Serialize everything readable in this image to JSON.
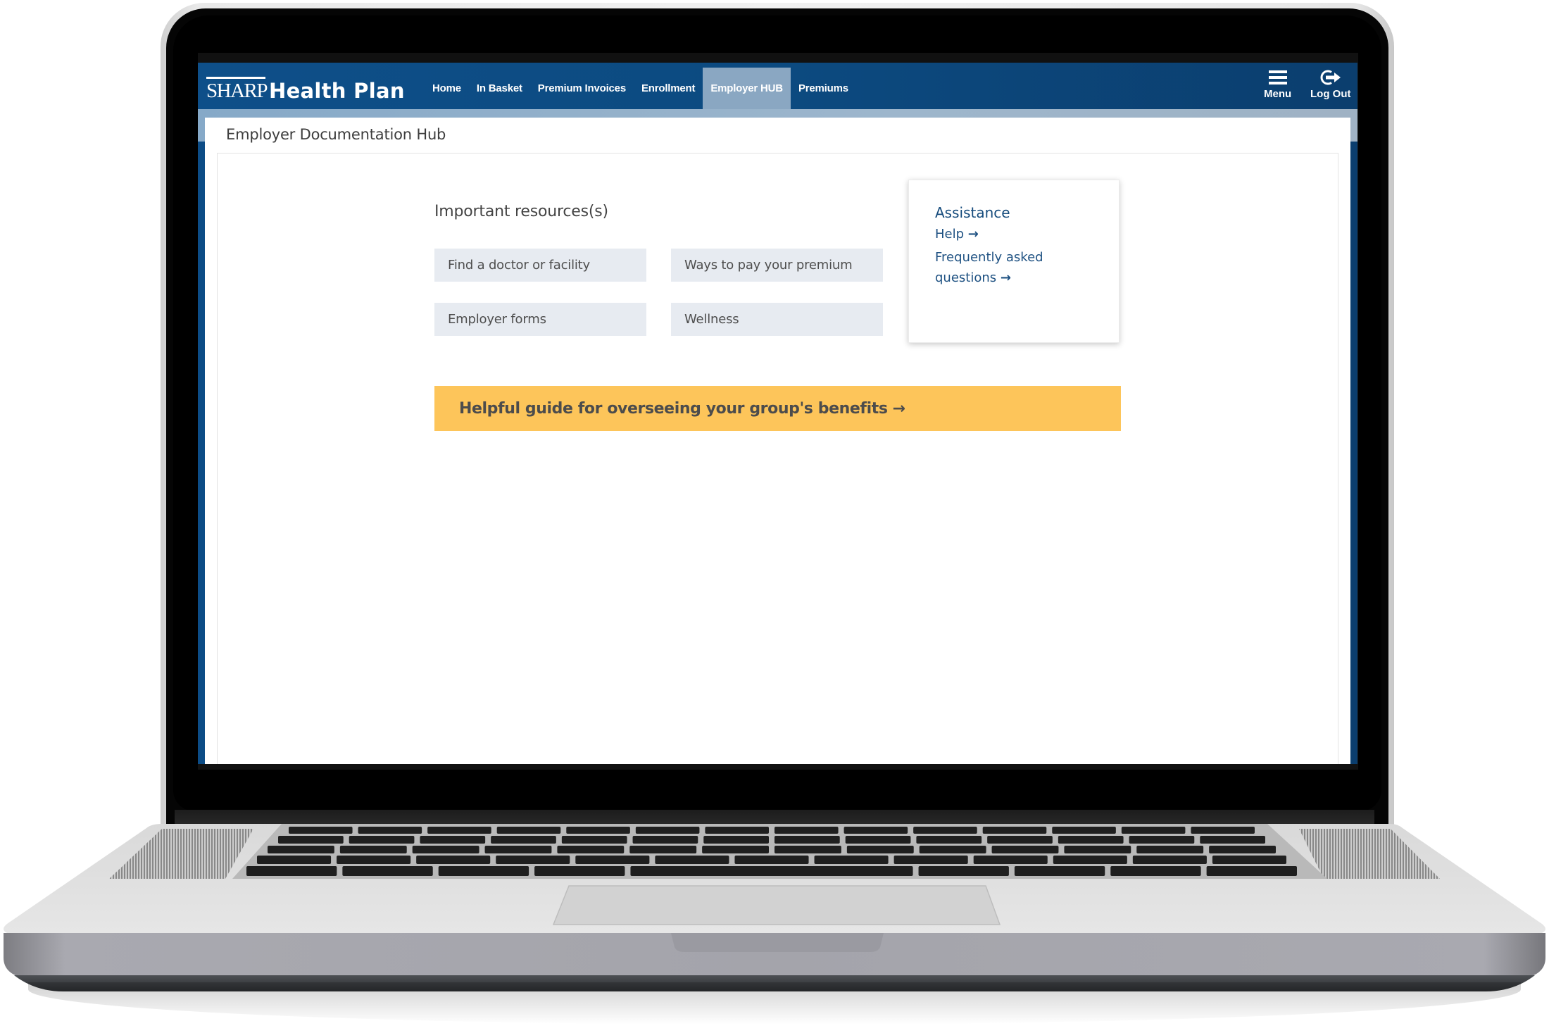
{
  "app": {
    "brand_sharp": "SHARP",
    "brand_rest": "Health Plan"
  },
  "nav": {
    "items": [
      {
        "label": "Home",
        "active": false
      },
      {
        "label": "In Basket",
        "active": false
      },
      {
        "label": "Premium Invoices",
        "active": false
      },
      {
        "label": "Enrollment",
        "active": false
      },
      {
        "label": "Employer HUB",
        "active": true
      },
      {
        "label": "Premiums",
        "active": false
      }
    ],
    "menu_label": "Menu",
    "logout_label": "Log Out",
    "menu_icon": "hamburger-icon",
    "logout_icon": "logout-icon"
  },
  "page": {
    "title": "Employer Documentation Hub"
  },
  "resources": {
    "heading": "Important resources(s)",
    "buttons": [
      {
        "label": "Find a doctor or facility"
      },
      {
        "label": "Ways to pay your premium"
      },
      {
        "label": "Employer forms"
      },
      {
        "label": "Wellness"
      }
    ]
  },
  "assistance": {
    "title": "Assistance",
    "links": [
      {
        "label": "Help",
        "arrow": "→"
      },
      {
        "label": "Frequently asked questions",
        "arrow": "→"
      }
    ]
  },
  "guide_banner": {
    "label": "Helpful guide for overseeing your group's benefits",
    "arrow": "→"
  },
  "colors": {
    "nav_blue": "#0c4c86",
    "active_tab": "#8aa7c2",
    "link_blue": "#1e5182",
    "banner_yellow": "#fdc55a",
    "resource_button_bg": "#e7ebf1"
  }
}
